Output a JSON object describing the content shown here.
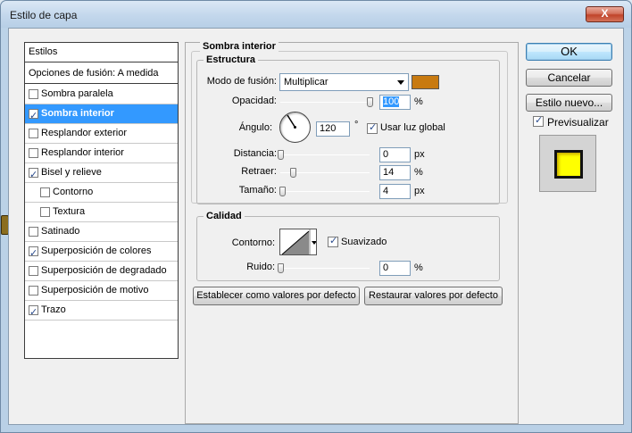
{
  "window": {
    "title": "Estilo de capa",
    "close_glyph": "X"
  },
  "styles_list": {
    "header": "Estilos",
    "blending": "Opciones de fusión: A medida",
    "items": [
      {
        "label": "Sombra paralela",
        "checked": false,
        "selected": false,
        "indent": false
      },
      {
        "label": "Sombra interior",
        "checked": true,
        "selected": true,
        "indent": false
      },
      {
        "label": "Resplandor exterior",
        "checked": false,
        "selected": false,
        "indent": false
      },
      {
        "label": "Resplandor interior",
        "checked": false,
        "selected": false,
        "indent": false
      },
      {
        "label": "Bisel y relieve",
        "checked": true,
        "selected": false,
        "indent": false
      },
      {
        "label": "Contorno",
        "checked": false,
        "selected": false,
        "indent": true
      },
      {
        "label": "Textura",
        "checked": false,
        "selected": false,
        "indent": true
      },
      {
        "label": "Satinado",
        "checked": false,
        "selected": false,
        "indent": false
      },
      {
        "label": "Superposición de colores",
        "checked": true,
        "selected": false,
        "indent": false
      },
      {
        "label": "Superposición de degradado",
        "checked": false,
        "selected": false,
        "indent": false
      },
      {
        "label": "Superposición de motivo",
        "checked": false,
        "selected": false,
        "indent": false
      },
      {
        "label": "Trazo",
        "checked": true,
        "selected": false,
        "indent": false
      }
    ]
  },
  "inner_shadow": {
    "section_title": "Sombra interior",
    "structure": {
      "group_title": "Estructura",
      "blend_mode_label": "Modo de fusión:",
      "blend_mode_value": "Multiplicar",
      "color": "#c87a10",
      "opacity_label": "Opacidad:",
      "opacity_value": "100",
      "opacity_fraction": 1.0,
      "angle_label": "Ángulo:",
      "angle_value": "120",
      "angle_unit": "°",
      "global_light_label": "Usar luz global",
      "global_light_checked": true,
      "distance_label": "Distancia:",
      "distance_value": "0",
      "distance_fraction": 0.0,
      "choke_label": "Retraer:",
      "choke_value": "14",
      "choke_fraction": 0.14,
      "size_label": "Tamaño:",
      "size_value": "4",
      "size_fraction": 0.016,
      "unit_px": "px",
      "unit_pct": "%"
    },
    "quality": {
      "group_title": "Calidad",
      "contour_label": "Contorno:",
      "antialias_label": "Suavizado",
      "antialias_checked": true,
      "noise_label": "Ruido:",
      "noise_value": "0",
      "noise_fraction": 0.0,
      "unit_pct": "%"
    },
    "set_default_button": "Establecer como valores por defecto",
    "reset_default_button": "Restaurar valores por defecto"
  },
  "actions": {
    "ok": "OK",
    "cancel": "Cancelar",
    "new_style": "Estilo nuevo...",
    "preview_label": "Previsualizar",
    "preview_checked": true,
    "preview_fill": "#ffff00"
  }
}
